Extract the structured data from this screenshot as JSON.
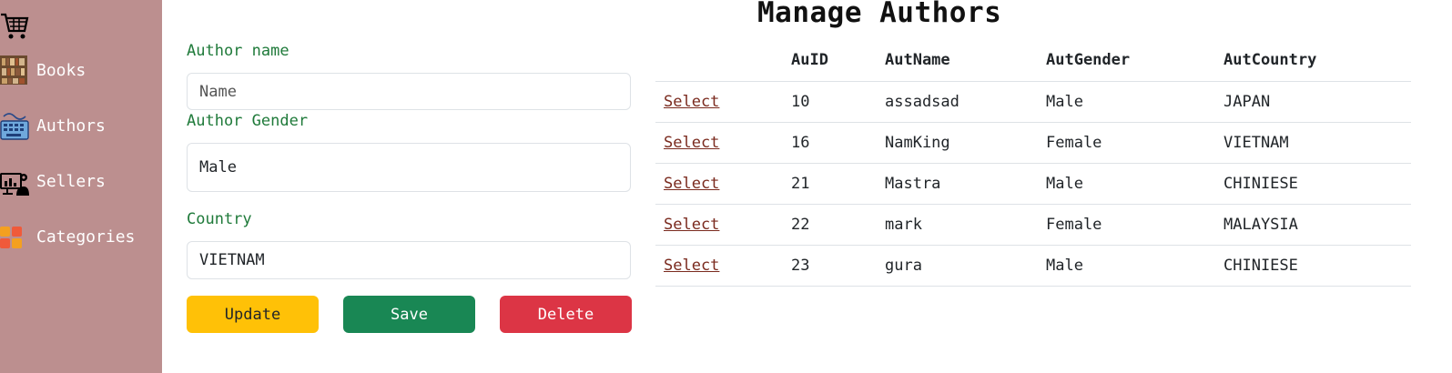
{
  "sidebar": {
    "items": [
      {
        "label": "Books",
        "icon": "books-icon"
      },
      {
        "label": "Authors",
        "icon": "keyboard-icon"
      },
      {
        "label": "Sellers",
        "icon": "seller-icon"
      },
      {
        "label": "Categories",
        "icon": "categories-icon"
      }
    ],
    "background": "#bc8f8f"
  },
  "page": {
    "title": "Manage Authors"
  },
  "form": {
    "name_label": "Author name",
    "name_placeholder": "Name",
    "name_value": "",
    "gender_label": "Author Gender",
    "gender_value": "Male",
    "country_label": "Country",
    "country_value": "VIETNAM",
    "label_color": "#1f7a3a"
  },
  "buttons": {
    "update": "Update",
    "save": "Save",
    "delete": "Delete",
    "colors": {
      "update": "#ffc107",
      "save": "#198754",
      "delete": "#dc3545"
    }
  },
  "table": {
    "headers": [
      "",
      "AuID",
      "AutName",
      "AutGender",
      "AutCountry"
    ],
    "select_label": "Select",
    "rows": [
      {
        "id": "10",
        "name": "assadsad",
        "gender": "Male",
        "country": "JAPAN"
      },
      {
        "id": "16",
        "name": "NamKing",
        "gender": "Female",
        "country": "VIETNAM"
      },
      {
        "id": "21",
        "name": "Mastra",
        "gender": "Male",
        "country": "CHINIESE"
      },
      {
        "id": "22",
        "name": "mark",
        "gender": "Female",
        "country": "MALAYSIA"
      },
      {
        "id": "23",
        "name": "gura",
        "gender": "Male",
        "country": "CHINIESE"
      }
    ]
  }
}
